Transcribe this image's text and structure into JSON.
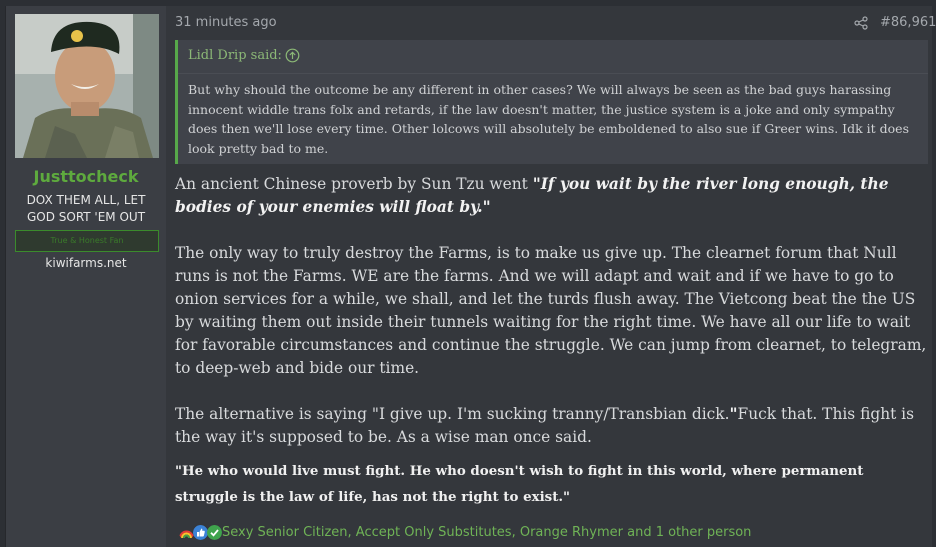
{
  "user": {
    "name": "Justtocheck",
    "title": "DOX THEM ALL, LET GOD SORT 'EM OUT",
    "banner": "True & Honest Fan",
    "site": "kiwifarms.net",
    "avatar_alt": "user avatar"
  },
  "post": {
    "time": "31 minutes ago",
    "number": "#86,961",
    "quote": {
      "author": "Lidl Drip said:",
      "text": "But why should the outcome be any different in other cases? We will always be seen as the bad guys harassing innocent widdle trans folx and retards, if the law doesn't matter, the justice system is a joke and only sympathy does then we'll lose every time. Other lolcows will absolutely be emboldened to also sue if Greer wins. Idk it does look pretty bad to me."
    },
    "p1_start": "An ancient Chinese proverb by Sun Tzu went ",
    "p1_quote": "\"If you wait by the river long enough, the bodies of your enemies will float by.\"",
    "p2": "The only way to truly destroy the Farms, is to make us give up. The clearnet forum that Null runs is not the Farms. WE are the farms. And we will adapt and wait and if we have to go to onion services for a while, we shall, and let the turds flush away. The Vietcong beat the the US by waiting them out inside their tunnels waiting for the right time. We have all our life to wait for favorable circumstances and continue the struggle. We can jump from clearnet, to telegram, to deep-web and bide our time.",
    "p3_start": "The alternative is saying \"I give up. I'm sucking tranny/Transbian dick.",
    "p3_mark": "\"",
    "p3_end": "Fuck that. This fight is the way it's supposed to be. As a wise man once said.",
    "p4": "\"He who would live must fight. He who doesn't wish to fight in this world, where permanent struggle is the law of life, has not the right to exist.\"",
    "reactions": {
      "text": "Sexy Senior Citizen, Accept Only Substitutes, Orange Rhymer and 1 other person",
      "icons": [
        "rainbow-icon",
        "thumbs-up-icon",
        "checkmark-icon"
      ]
    }
  }
}
